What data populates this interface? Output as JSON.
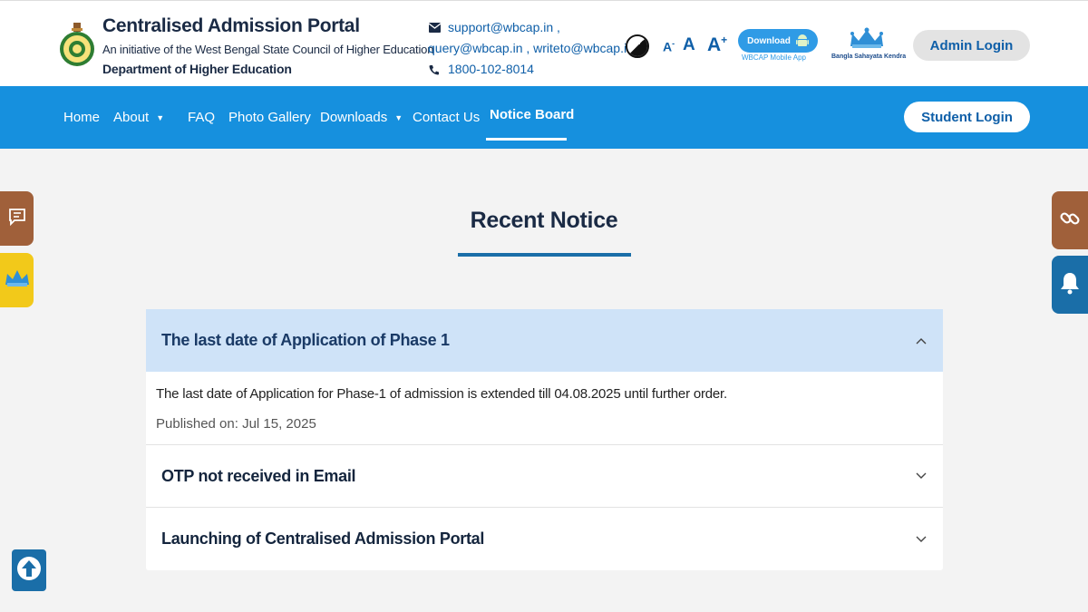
{
  "header": {
    "title": "Centralised Admission Portal",
    "subtitle": "An initiative of the West Bengal State Council of Higher Education",
    "department": "Department of Higher Education",
    "email_line1": "support@wbcap.in ,",
    "email_line2": "query@wbcap.in , writeto@wbcap.in",
    "phone": "1800-102-8014",
    "font_small": "A",
    "font_small_sup": "-",
    "font_normal": "A",
    "font_large": "A",
    "font_large_sup": "+",
    "download_label": "Download",
    "download_caption": "WBCAP Mobile App",
    "bsk_caption": "Bangla Sahayata Kendra",
    "admin_login": "Admin Login"
  },
  "nav": {
    "items": [
      {
        "label": "Home"
      },
      {
        "label": "About"
      },
      {
        "label": "FAQ"
      },
      {
        "label": "Photo Gallery"
      },
      {
        "label": "Downloads"
      },
      {
        "label": "Contact Us"
      },
      {
        "label": "Notice Board"
      }
    ],
    "student_login": "Student Login"
  },
  "main": {
    "title": "Recent Notice",
    "notices": [
      {
        "title": "The last date of Application of Phase 1",
        "body": "The last date of Application for Phase-1 of admission is extended till 04.08.2025 until further order.",
        "published": "Published on: Jul 15, 2025",
        "expanded": true
      },
      {
        "title": "OTP not received in Email",
        "expanded": false
      },
      {
        "title": "Launching of Centralised Admission Portal",
        "expanded": false
      }
    ]
  },
  "colors": {
    "nav_bg": "#1690de",
    "accent": "#1a6ea8",
    "side_tab_brown": "#a0603a",
    "side_tab_yellow": "#f2c91a",
    "open_notice_bg": "#cfe3f8"
  },
  "icons": [
    "logo-emblem",
    "mail-icon",
    "phone-icon",
    "contrast-icon",
    "android-icon",
    "bsk-logo",
    "feedback-icon",
    "bsk-tab-icon",
    "link-icon",
    "bell-icon",
    "chevron-up-icon",
    "chevron-down-icon",
    "arrow-up-icon"
  ]
}
